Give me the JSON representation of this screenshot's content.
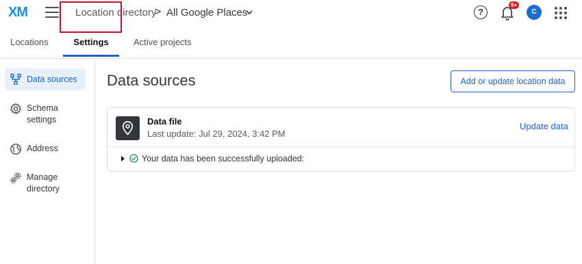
{
  "header": {
    "logo": "XM",
    "breadcrumb_parent": "Location directory",
    "breadcrumb_separator": ">",
    "breadcrumb_current": "All Google Places",
    "help": "?",
    "notification_badge": "9+",
    "avatar_initial": "C"
  },
  "tabs": [
    {
      "label": "Locations"
    },
    {
      "label": "Settings"
    },
    {
      "label": "Active projects"
    }
  ],
  "sidebar": {
    "items": [
      {
        "label": "Data sources",
        "icon": "data-sources-icon"
      },
      {
        "label": "Schema settings",
        "icon": "gear-icon"
      },
      {
        "label": "Address",
        "icon": "globe-icon"
      },
      {
        "label": "Manage directory",
        "icon": "gears-icon"
      }
    ]
  },
  "main": {
    "title": "Data sources",
    "add_button": "Add or update location data",
    "card": {
      "title": "Data file",
      "last_update": "Last update: Jul 29, 2024, 3:42 PM",
      "update_link": "Update data",
      "status": "Your data has been successfully uploaded:"
    }
  },
  "colors": {
    "accent": "#1b62c9",
    "logo": "#1a8fe8",
    "highlight_box": "#c8102e",
    "badge": "#d1221f",
    "success": "#2e8b57"
  }
}
